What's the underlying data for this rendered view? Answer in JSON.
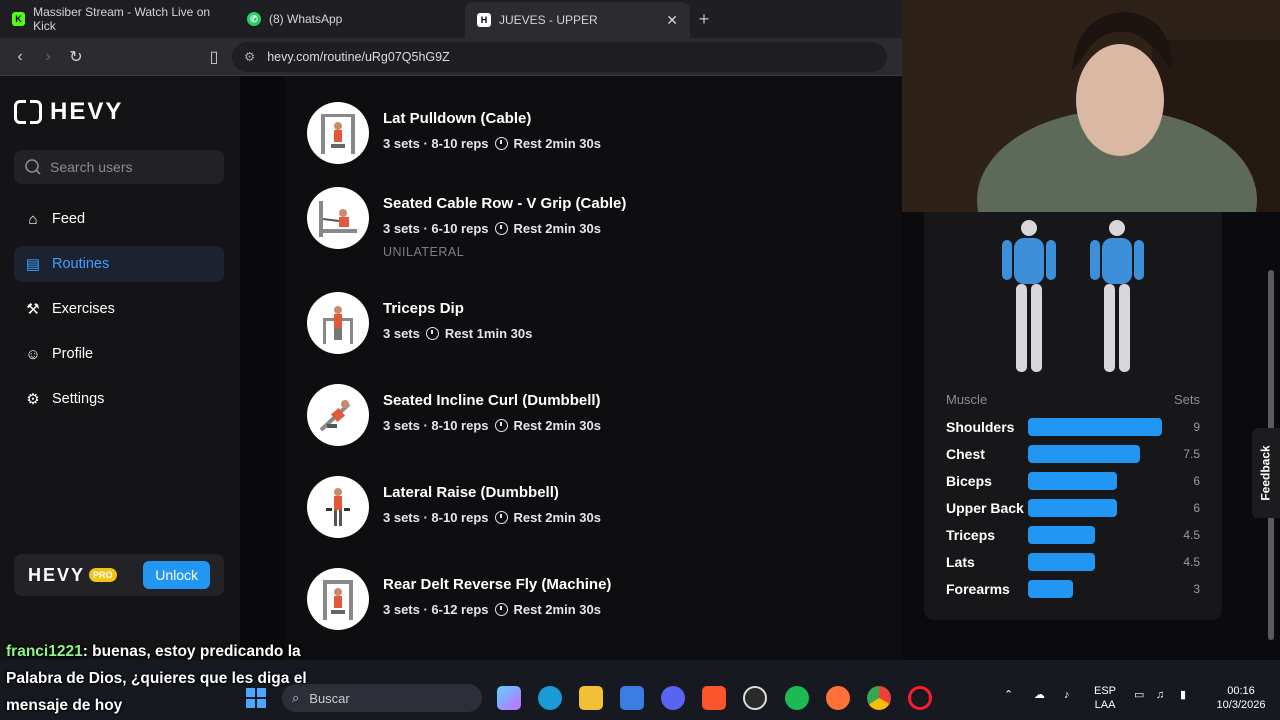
{
  "browser": {
    "tabs": [
      {
        "label": "Massiber Stream - Watch Live on Kick",
        "favicon": "kick-icon",
        "color": "#53fc18"
      },
      {
        "label": "(8) WhatsApp",
        "favicon": "whatsapp-icon",
        "color": "#25d366"
      },
      {
        "label": "JUEVES - UPPER",
        "favicon": "hevy-icon",
        "color": "#ffffff"
      }
    ],
    "url": "hevy.com/routine/uRg07Q5hG9Z"
  },
  "sidebar": {
    "logo": "HEVY",
    "search_placeholder": "Search users",
    "items": [
      {
        "label": "Feed",
        "icon": "home-icon"
      },
      {
        "label": "Routines",
        "icon": "clipboard-icon"
      },
      {
        "label": "Exercises",
        "icon": "dumbbell-icon"
      },
      {
        "label": "Profile",
        "icon": "user-icon"
      },
      {
        "label": "Settings",
        "icon": "gear-icon"
      }
    ],
    "pro": {
      "logo": "HEVY",
      "badge": "PRO",
      "button": "Unlock"
    }
  },
  "exercises": [
    {
      "name": "Lat Pulldown (Cable)",
      "sets": "3 sets · 8-10 reps",
      "rest": "Rest 2min 30s",
      "note": ""
    },
    {
      "name": "Seated Cable Row - V Grip (Cable)",
      "sets": "3 sets · 6-10 reps",
      "rest": "Rest 2min 30s",
      "note": "UNILATERAL"
    },
    {
      "name": "Triceps Dip",
      "sets": "3 sets",
      "rest": "Rest 1min 30s",
      "note": ""
    },
    {
      "name": "Seated Incline Curl (Dumbbell)",
      "sets": "3 sets · 8-10 reps",
      "rest": "Rest 2min 30s",
      "note": ""
    },
    {
      "name": "Lateral Raise (Dumbbell)",
      "sets": "3 sets · 8-10 reps",
      "rest": "Rest 2min 30s",
      "note": ""
    },
    {
      "name": "Rear Delt Reverse Fly (Machine)",
      "sets": "3 sets · 6-12 reps",
      "rest": "Rest 2min 30s",
      "note": ""
    }
  ],
  "muscles": {
    "header_muscle": "Muscle",
    "header_sets": "Sets",
    "max": 9,
    "rows": [
      {
        "name": "Shoulders",
        "sets": 9,
        "label": "9"
      },
      {
        "name": "Chest",
        "sets": 7.5,
        "label": "7.5"
      },
      {
        "name": "Biceps",
        "sets": 6,
        "label": "6"
      },
      {
        "name": "Upper Back",
        "sets": 6,
        "label": "6"
      },
      {
        "name": "Triceps",
        "sets": 4.5,
        "label": "4.5"
      },
      {
        "name": "Lats",
        "sets": 4.5,
        "label": "4.5"
      },
      {
        "name": "Forearms",
        "sets": 3,
        "label": "3"
      }
    ],
    "accent": "#2196f3"
  },
  "feedback": "Feedback",
  "chat": {
    "user": "franci1221",
    "message": ": buenas, estoy predicando la Palabra de Dios, ¿quieres que les diga el mensaje de hoy"
  },
  "taskbar": {
    "search": "Buscar",
    "lang_top": "ESP",
    "lang_bottom": "LAA",
    "time": "00:16",
    "date": "10/3/2026"
  }
}
